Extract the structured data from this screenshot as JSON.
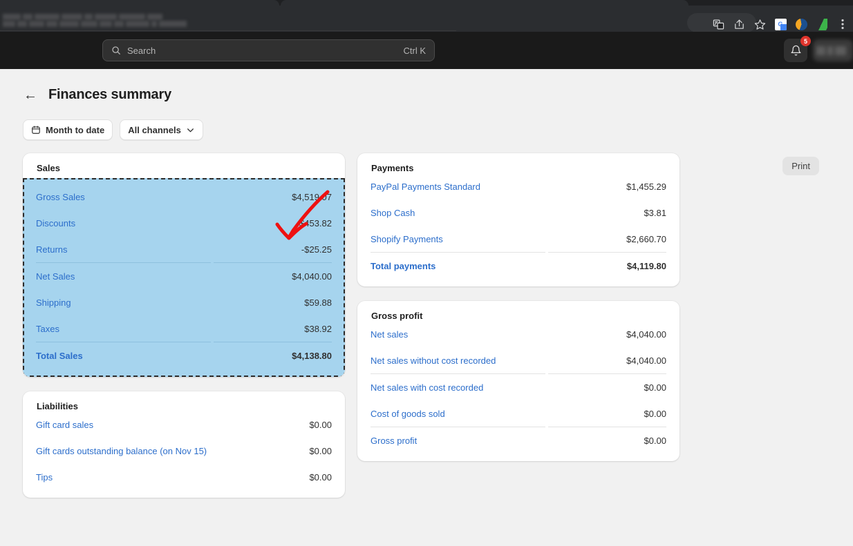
{
  "browser": {
    "toolbar_icons": [
      "translate-icon",
      "share-icon",
      "bookmark-star-icon"
    ],
    "extension_icons": [
      "google-translate-extension-icon",
      "swirl-extension-icon",
      "green-pen-extension-icon"
    ],
    "menu_icon": "browser-menu-icon"
  },
  "topbar": {
    "search": {
      "placeholder": "Search",
      "shortcut": "Ctrl K",
      "icon": "search-icon"
    },
    "notifications": {
      "icon": "bell-icon",
      "badge": "5"
    },
    "account": "account-chip"
  },
  "header": {
    "back_icon": "arrow-left-icon",
    "title": "Finances summary",
    "print_label": "Print"
  },
  "filters": [
    {
      "label": "Month to date",
      "icon": "calendar-icon",
      "has_chevron": false
    },
    {
      "label": "All channels",
      "icon": "",
      "has_chevron": true
    }
  ],
  "cards": {
    "sales": {
      "title": "Sales",
      "selected": true,
      "rows": [
        {
          "label": "Gross Sales",
          "value": "$4,519.07",
          "bold": false,
          "sep_after": false
        },
        {
          "label": "Discounts",
          "value": "-$453.82",
          "bold": false,
          "sep_after": false
        },
        {
          "label": "Returns",
          "value": "-$25.25",
          "bold": false,
          "sep_after": true
        },
        {
          "label": "Net Sales",
          "value": "$4,040.00",
          "bold": false,
          "sep_after": false
        },
        {
          "label": "Shipping",
          "value": "$59.88",
          "bold": false,
          "sep_after": false
        },
        {
          "label": "Taxes",
          "value": "$38.92",
          "bold": false,
          "sep_after": true
        },
        {
          "label": "Total Sales",
          "value": "$4,138.80",
          "bold": true,
          "sep_after": false
        }
      ]
    },
    "liabilities": {
      "title": "Liabilities",
      "rows": [
        {
          "label": "Gift card sales",
          "value": "$0.00",
          "bold": false,
          "sep_after": false
        },
        {
          "label": "Gift cards outstanding balance (on Nov 15)",
          "value": "$0.00",
          "bold": false,
          "sep_after": false
        },
        {
          "label": "Tips",
          "value": "$0.00",
          "bold": false,
          "sep_after": false
        }
      ]
    },
    "payments": {
      "title": "Payments",
      "rows": [
        {
          "label": "PayPal Payments Standard",
          "value": "$1,455.29",
          "bold": false,
          "sep_after": false
        },
        {
          "label": "Shop Cash",
          "value": "$3.81",
          "bold": false,
          "sep_after": false
        },
        {
          "label": "Shopify Payments",
          "value": "$2,660.70",
          "bold": false,
          "sep_after": true
        },
        {
          "label": "Total payments",
          "value": "$4,119.80",
          "bold": true,
          "sep_after": false
        }
      ]
    },
    "gross_profit": {
      "title": "Gross profit",
      "rows": [
        {
          "label": "Net sales",
          "value": "$4,040.00",
          "bold": false,
          "sep_after": false
        },
        {
          "label": "Net sales without cost recorded",
          "value": "$4,040.00",
          "bold": false,
          "sep_after": true
        },
        {
          "label": "Net sales with cost recorded",
          "value": "$0.00",
          "bold": false,
          "sep_after": false
        },
        {
          "label": "Cost of goods sold",
          "value": "$0.00",
          "bold": false,
          "sep_after": true
        },
        {
          "label": "Gross profit",
          "value": "$0.00",
          "bold": false,
          "sep_after": false
        }
      ]
    }
  },
  "annotation": {
    "type": "red-arrow",
    "color": "#ee1111"
  },
  "colors": {
    "link": "#2c6ecb",
    "selection_fill": "#a6d4ee",
    "selection_border": "#2b2b2b",
    "page_bg": "#f1f1f1",
    "topbar_bg": "#1a1a1a",
    "badge": "#e0342c"
  }
}
